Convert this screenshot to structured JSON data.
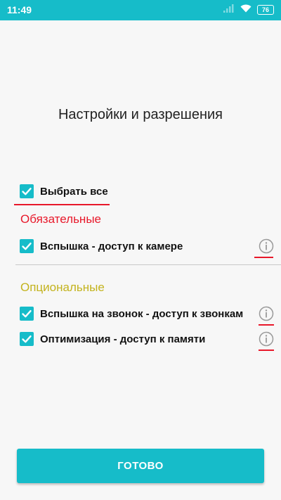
{
  "status_bar": {
    "time": "11:49",
    "battery": "76",
    "icons": [
      "signal-icon",
      "wifi-icon",
      "battery-icon"
    ],
    "color": "#16bcc9"
  },
  "title": "Настройки и разрешения",
  "select_all": {
    "label": "Выбрать все",
    "checked": true
  },
  "required_section": {
    "title": "Обязательные",
    "color": "#e8182a",
    "items": [
      {
        "label": "Вспышка - доступ к камере",
        "checked": true,
        "icon": "info-icon"
      }
    ]
  },
  "optional_section": {
    "title": "Опциональные",
    "color": "#c3b31d",
    "items": [
      {
        "label": "Вспышка на звонок - доступ к звонкам",
        "checked": true,
        "icon": "info-icon"
      },
      {
        "label": "Оптимизация - доступ к памяти",
        "checked": true,
        "icon": "info-icon"
      }
    ]
  },
  "done_button": {
    "label": "ГОТОВО"
  },
  "colors": {
    "accent": "#16bcc9",
    "annotation_underline": "#e8182a"
  }
}
